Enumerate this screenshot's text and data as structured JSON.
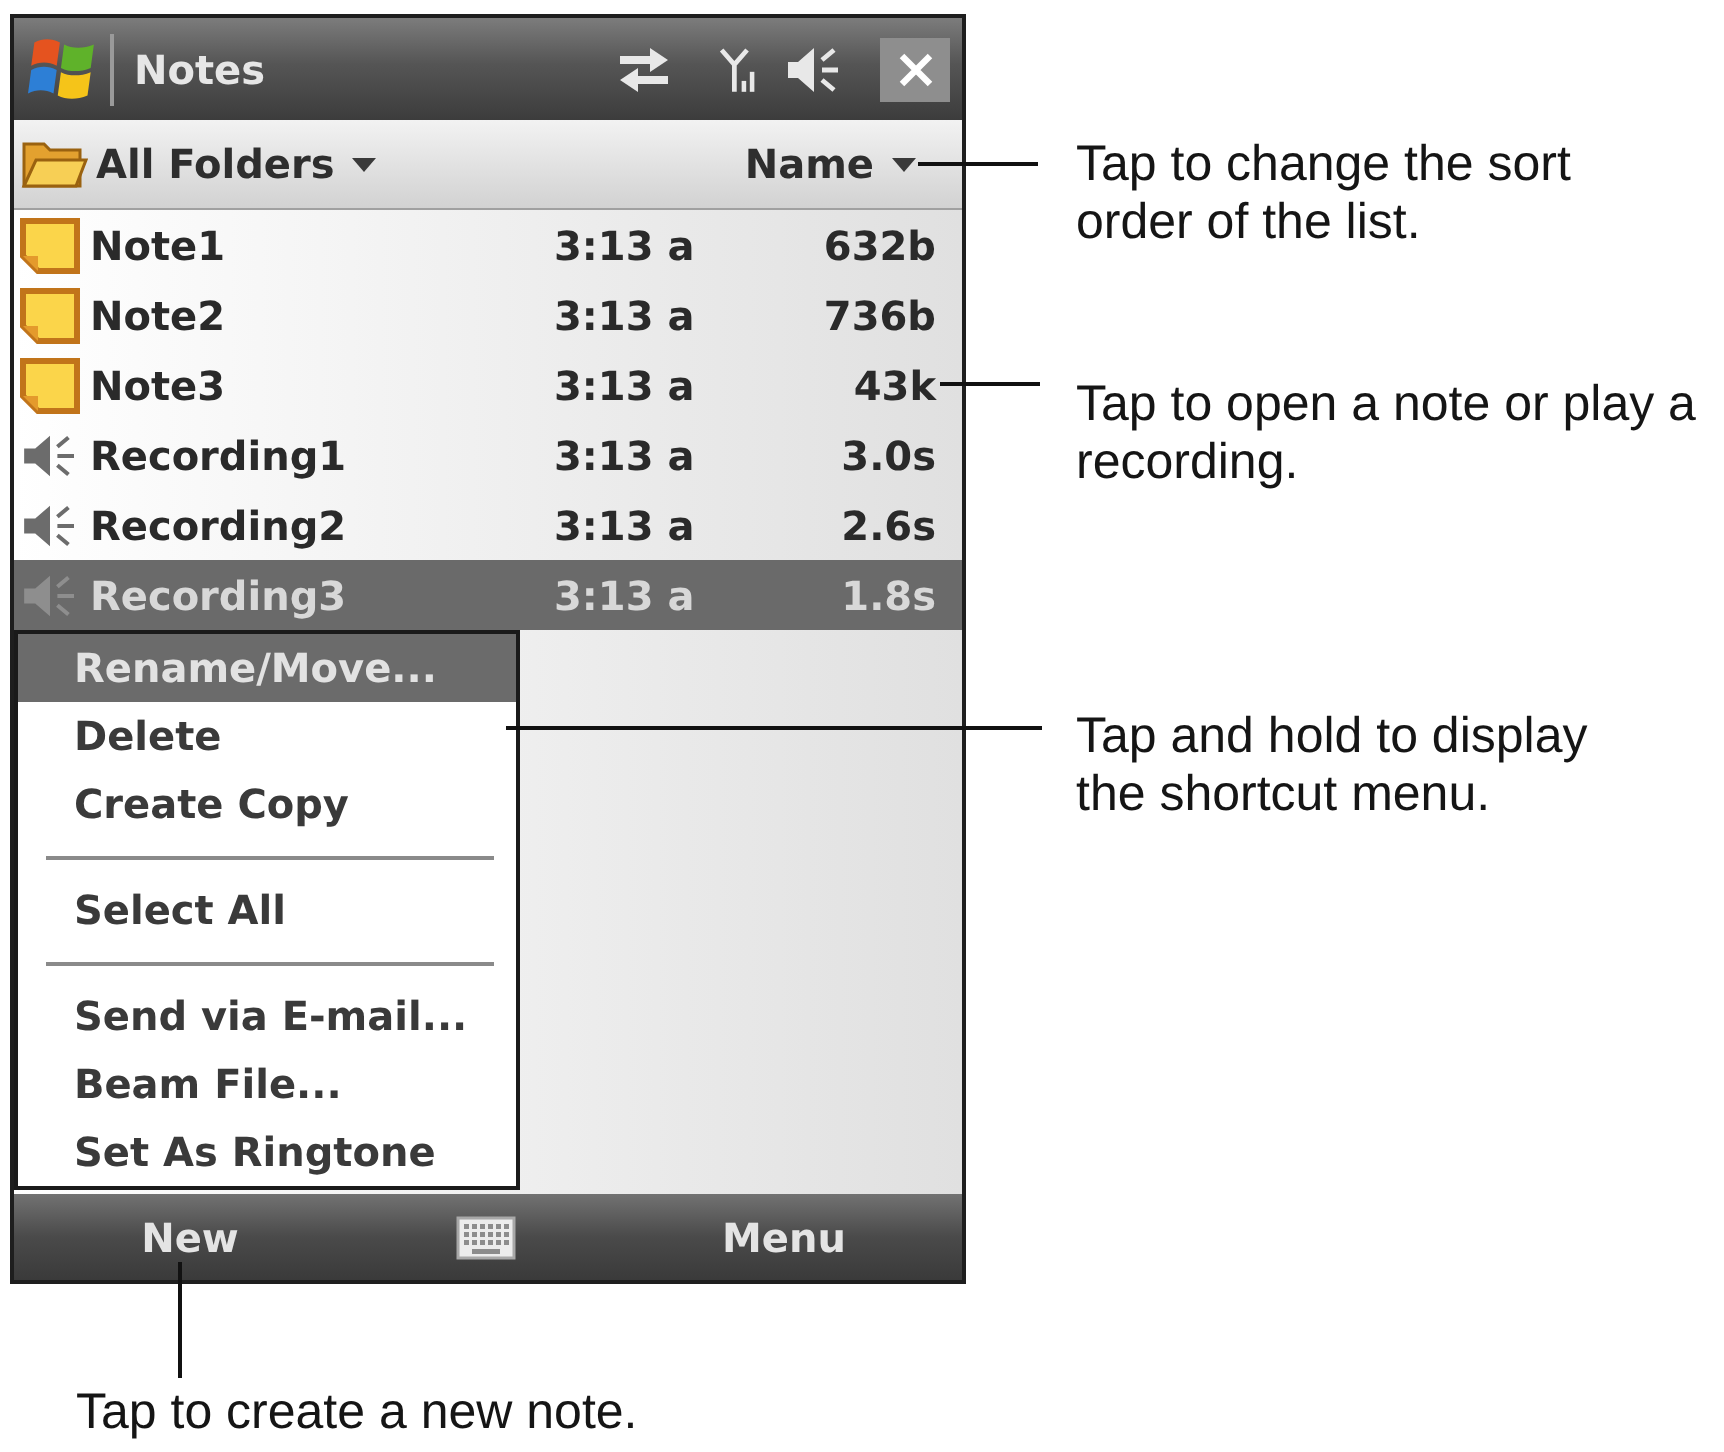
{
  "title_bar": {
    "title": "Notes"
  },
  "header": {
    "folder": "All Folders",
    "sort": "Name"
  },
  "rows": [
    {
      "kind": "note",
      "name": "Note1",
      "time": "3:13 a",
      "size": "632b",
      "selected": false
    },
    {
      "kind": "note",
      "name": "Note2",
      "time": "3:13 a",
      "size": "736b",
      "selected": false
    },
    {
      "kind": "note",
      "name": "Note3",
      "time": "3:13 a",
      "size": "43k",
      "selected": false
    },
    {
      "kind": "recording",
      "name": "Recording1",
      "time": "3:13 a",
      "size": "3.0s",
      "selected": false
    },
    {
      "kind": "recording",
      "name": "Recording2",
      "time": "3:13 a",
      "size": "2.6s",
      "selected": false
    },
    {
      "kind": "recording",
      "name": "Recording3",
      "time": "3:13 a",
      "size": "1.8s",
      "selected": true
    }
  ],
  "context_menu": {
    "items": [
      {
        "kind": "item",
        "label": "Rename/Move...",
        "selected": true
      },
      {
        "kind": "item",
        "label": "Delete",
        "selected": false
      },
      {
        "kind": "item",
        "label": "Create Copy",
        "selected": false
      },
      {
        "kind": "separator"
      },
      {
        "kind": "item",
        "label": "Select All",
        "selected": false
      },
      {
        "kind": "separator"
      },
      {
        "kind": "item",
        "label": "Send via E-mail...",
        "selected": false
      },
      {
        "kind": "item",
        "label": "Beam File...",
        "selected": false
      },
      {
        "kind": "item",
        "label": "Set As Ringtone",
        "selected": false
      }
    ]
  },
  "soft_keys": {
    "left": "New",
    "right": "Menu"
  },
  "callouts": [
    {
      "text": "Tap to change the sort\norder of the list."
    },
    {
      "text": "Tap to open a note or play a\nrecording."
    },
    {
      "text": "Tap and hold to display\nthe shortcut menu."
    },
    {
      "text": "Tap to create a new note."
    }
  ]
}
